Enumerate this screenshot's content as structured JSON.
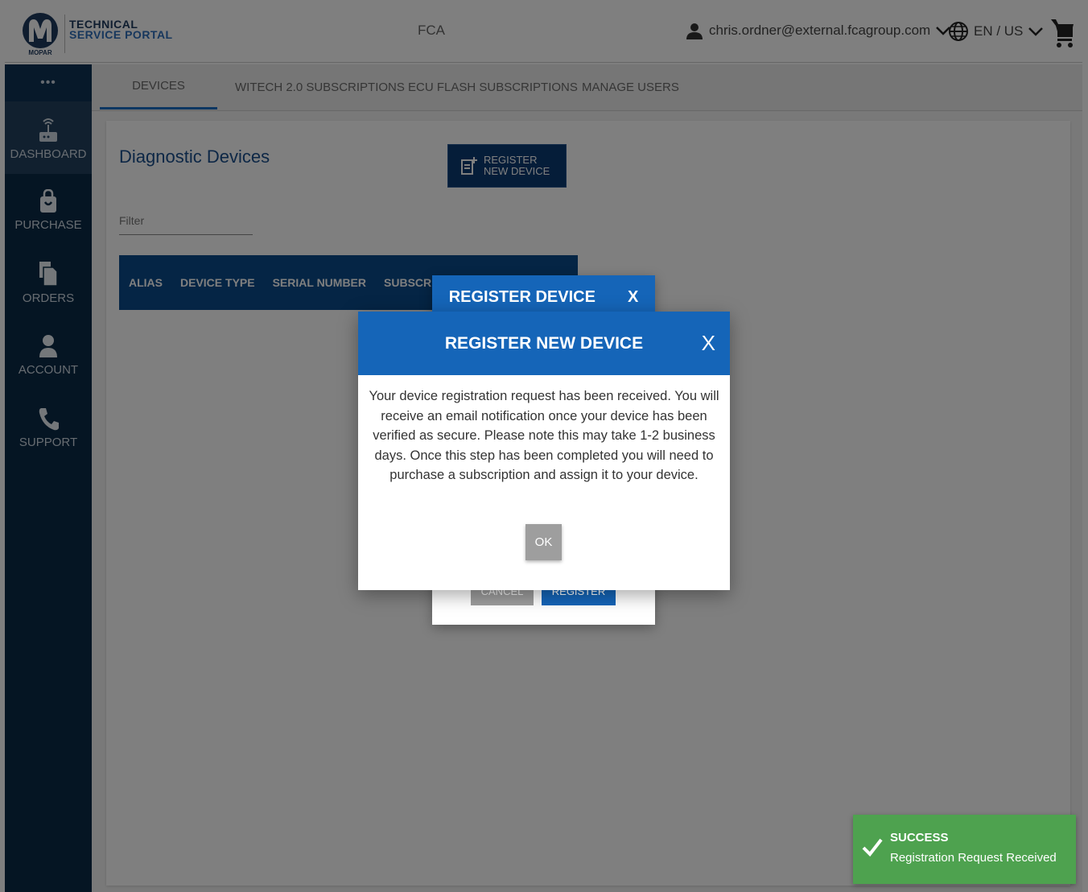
{
  "header": {
    "brand_line1": "TECHNICAL",
    "brand_line2": "SERVICE PORTAL",
    "logo_text": "MOPAR",
    "center": "FCA",
    "user_email": "chris.ordner@external.fcagroup.com",
    "language": "EN / US"
  },
  "sidebar": {
    "more": "•••",
    "items": [
      {
        "label": "DASHBOARD",
        "icon": "router-icon"
      },
      {
        "label": "PURCHASE",
        "icon": "shopping-bag-icon"
      },
      {
        "label": "ORDERS",
        "icon": "documents-icon"
      },
      {
        "label": "ACCOUNT",
        "icon": "person-icon"
      },
      {
        "label": "SUPPORT",
        "icon": "phone-icon"
      }
    ]
  },
  "tabs": [
    "DEVICES",
    "WITECH 2.0 SUBSCRIPTIONS",
    "ECU FLASH SUBSCRIPTIONS",
    "MANAGE USERS"
  ],
  "page": {
    "title": "Diagnostic Devices",
    "register_button": "REGISTER NEW DEVICE",
    "filter_placeholder": "Filter",
    "columns": [
      "ALIAS",
      "DEVICE TYPE",
      "SERIAL NUMBER",
      "SUBSCRIPT"
    ]
  },
  "back_modal": {
    "title": "REGISTER DEVICE",
    "close": "X",
    "cancel": "CANCEL",
    "register": "REGISTER"
  },
  "modal": {
    "title": "REGISTER NEW DEVICE",
    "close": "X",
    "message": "Your device registration request has been received. You will receive an email notification once your device has been verified as secure. Please note this may take 1-2 business days. Once this step has been completed you will need to purchase a subscription and assign it to your device.",
    "ok": "OK"
  },
  "toast": {
    "title": "SUCCESS",
    "message": "Registration Request Received"
  },
  "colors": {
    "sidebar": "#0a2a47",
    "modal_header": "#1565b8",
    "toast": "#4ea24f",
    "tab_active": "#1a6fc4"
  }
}
